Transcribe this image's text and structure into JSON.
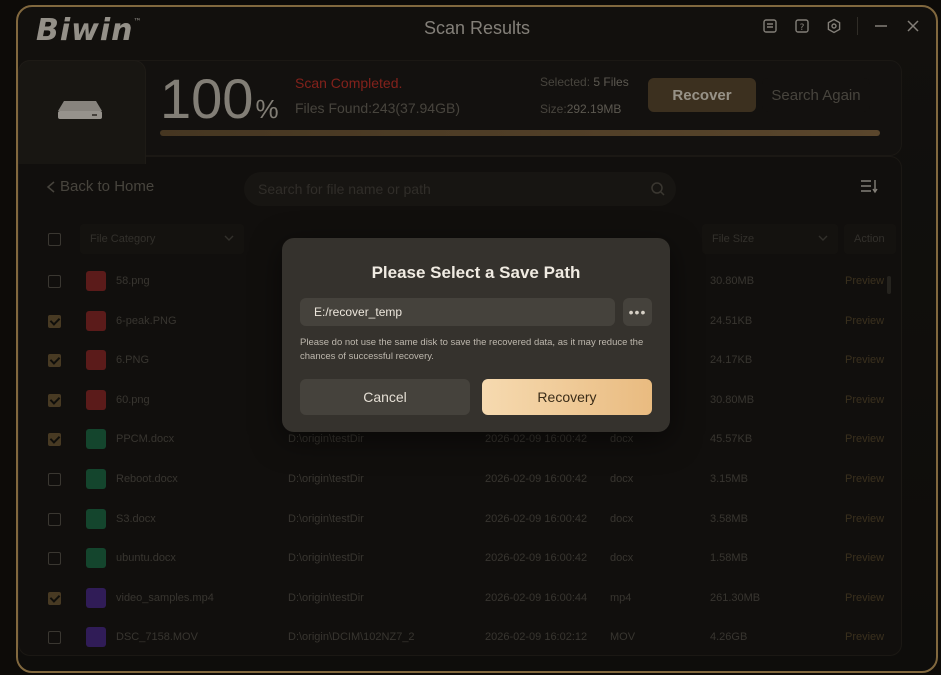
{
  "app": {
    "logo": "Biwin",
    "logo_tm": "™",
    "title": "Scan Results"
  },
  "titlebar": {
    "icons": [
      "feedback-icon",
      "help-icon",
      "settings-icon",
      "minimize-icon",
      "close-icon"
    ]
  },
  "scan": {
    "percent": "100",
    "percent_sign": "%",
    "status": "Scan Completed.",
    "files_found": "Files Found:243(37.94GB)",
    "selected_label": "Selected:",
    "selected_value": "5 Files",
    "size_label": "Size:",
    "size_value": "292.19MB",
    "recover_label": "Recover",
    "search_again_label": "Search Again",
    "progress": 1.0
  },
  "nav": {
    "back_label": "Back to Home"
  },
  "search": {
    "placeholder": "Search for file name or path"
  },
  "table": {
    "headers": {
      "category": "File Category",
      "size": "File Size",
      "action": "Action"
    },
    "rows": [
      {
        "name": "58.png",
        "path": "",
        "date": "",
        "type": "",
        "size": "30.80MB",
        "action": "Preview",
        "kind": "img",
        "checked": false
      },
      {
        "name": "6-peak.PNG",
        "path": "",
        "date": "",
        "type": "",
        "size": "24.51KB",
        "action": "Preview",
        "kind": "img",
        "checked": true
      },
      {
        "name": "6.PNG",
        "path": "",
        "date": "",
        "type": "",
        "size": "24.17KB",
        "action": "Preview",
        "kind": "img",
        "checked": true
      },
      {
        "name": "60.png",
        "path": "",
        "date": "",
        "type": "",
        "size": "30.80MB",
        "action": "Preview",
        "kind": "img",
        "checked": true
      },
      {
        "name": "PPCM.docx",
        "path": "D:\\origin\\testDir",
        "date": "2026-02-09 16:00:42",
        "type": "docx",
        "size": "45.57KB",
        "action": "Preview",
        "kind": "doc",
        "checked": true
      },
      {
        "name": "Reboot.docx",
        "path": "D:\\origin\\testDir",
        "date": "2026-02-09 16:00:42",
        "type": "docx",
        "size": "3.15MB",
        "action": "Preview",
        "kind": "doc",
        "checked": false
      },
      {
        "name": "S3.docx",
        "path": "D:\\origin\\testDir",
        "date": "2026-02-09 16:00:42",
        "type": "docx",
        "size": "3.58MB",
        "action": "Preview",
        "kind": "doc",
        "checked": false
      },
      {
        "name": "ubuntu.docx",
        "path": "D:\\origin\\testDir",
        "date": "2026-02-09 16:00:42",
        "type": "docx",
        "size": "1.58MB",
        "action": "Preview",
        "kind": "doc",
        "checked": false
      },
      {
        "name": "video_samples.mp4",
        "path": "D:\\origin\\testDir",
        "date": "2026-02-09 16:00:44",
        "type": "mp4",
        "size": "261.30MB",
        "action": "Preview",
        "kind": "vid",
        "checked": true
      },
      {
        "name": "DSC_7158.MOV",
        "path": "D:\\origin\\DCIM\\102NZ7_2",
        "date": "2026-02-09 16:02:12",
        "type": "MOV",
        "size": "4.26GB",
        "action": "Preview",
        "kind": "vid",
        "checked": false
      }
    ]
  },
  "dialog": {
    "title": "Please Select a Save Path",
    "path_value": "E:/recover_temp",
    "browse_label": "•••",
    "note": "Please do not use the same disk to save the recovered data, as it may reduce the chances of successful recovery.",
    "cancel_label": "Cancel",
    "recovery_label": "Recovery"
  },
  "colors": {
    "accent": "#c6a060",
    "error": "#c8342a",
    "primary_button": "#e9bb80"
  }
}
